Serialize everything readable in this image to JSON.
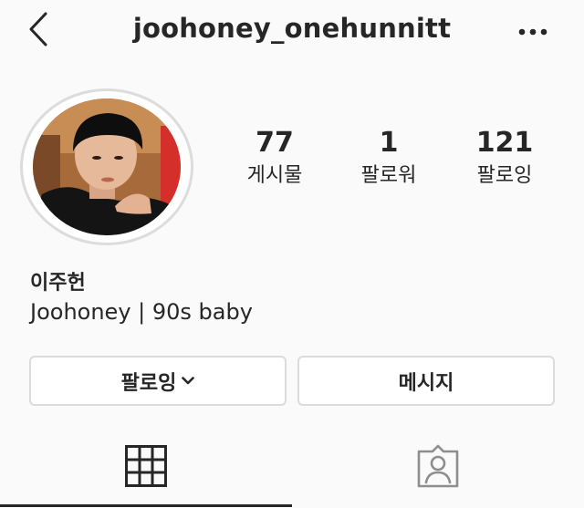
{
  "header": {
    "username": "joohoney_onehunnitt",
    "back_icon": "chevron-left-icon",
    "more_icon": "more-horizontal-icon"
  },
  "profile": {
    "avatar": "profile-photo",
    "stats": [
      {
        "number": "77",
        "label": "게시물"
      },
      {
        "number": "1",
        "label": "팔로워"
      },
      {
        "number": "121",
        "label": "팔로잉"
      }
    ],
    "name": "이주헌",
    "bio": "Joohoney | 90s baby"
  },
  "actions": {
    "following_label": "팔로잉",
    "message_label": "메시지"
  },
  "tabs": {
    "grid_icon": "grid-icon",
    "tagged_icon": "tagged-person-icon",
    "active": "grid"
  }
}
